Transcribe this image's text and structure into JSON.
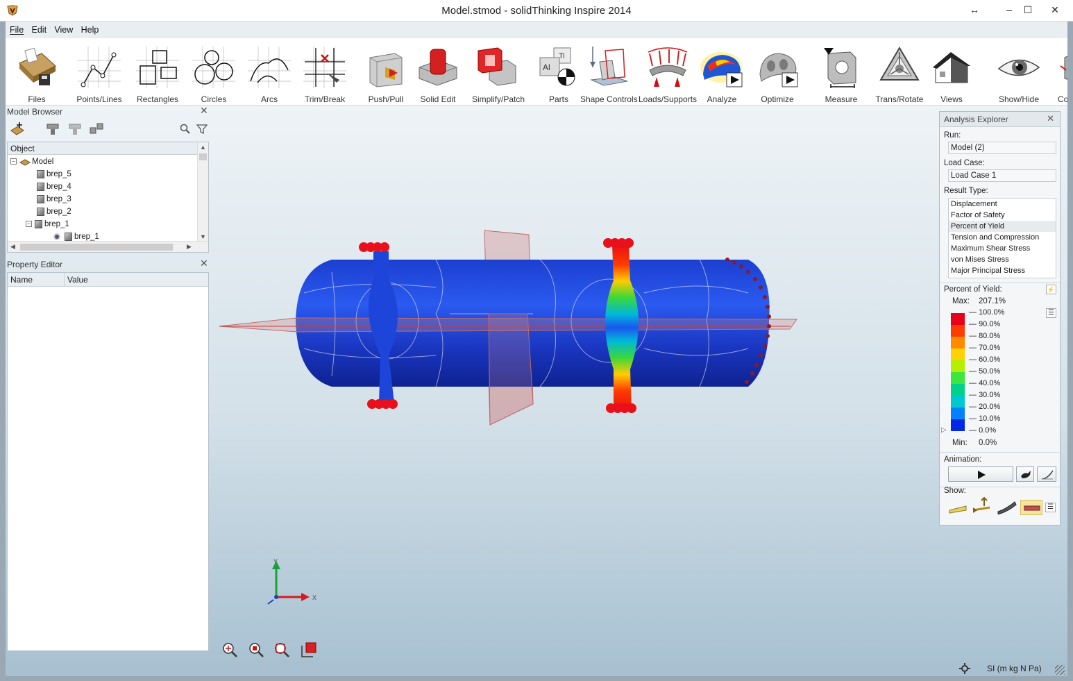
{
  "window": {
    "title": "Model.stmod - solidThinking Inspire 2014",
    "controls": {
      "restore_arrows": "↔",
      "minimize": "–",
      "maximize": "☐",
      "close": "✕"
    }
  },
  "menu": [
    "File",
    "Edit",
    "View",
    "Help"
  ],
  "toolbar": [
    {
      "label": "Files",
      "icon": "files-icon"
    },
    {
      "label": "Points/Lines",
      "icon": "points-lines-icon"
    },
    {
      "label": "Rectangles",
      "icon": "rectangles-icon"
    },
    {
      "label": "Circles",
      "icon": "circles-icon"
    },
    {
      "label": "Arcs",
      "icon": "arcs-icon"
    },
    {
      "label": "Trim/Break",
      "icon": "trim-break-icon"
    },
    {
      "label": "Push/Pull",
      "icon": "push-pull-icon"
    },
    {
      "label": "Solid Edit",
      "icon": "solid-edit-icon"
    },
    {
      "label": "Simplify/Patch",
      "icon": "simplify-patch-icon"
    },
    {
      "label": "Parts",
      "icon": "parts-icon"
    },
    {
      "label": "Shape Controls",
      "icon": "shape-controls-icon"
    },
    {
      "label": "Loads/Supports",
      "icon": "loads-supports-icon"
    },
    {
      "label": "Analyze",
      "icon": "analyze-icon"
    },
    {
      "label": "Optimize",
      "icon": "optimize-icon"
    },
    {
      "label": "Measure",
      "icon": "measure-icon"
    },
    {
      "label": "Trans/Rotate",
      "icon": "trans-rotate-icon"
    },
    {
      "label": "Views",
      "icon": "views-icon"
    },
    {
      "label": "Show/Hide",
      "icon": "show-hide-icon"
    },
    {
      "label": "Co",
      "icon": "cut-off-icon"
    }
  ],
  "model_browser": {
    "title": "Model Browser",
    "close": "✕",
    "column_header": "Object",
    "tree": [
      {
        "label": "Model",
        "level": 0,
        "expander": "−"
      },
      {
        "label": "brep_5",
        "level": 1
      },
      {
        "label": "brep_4",
        "level": 1
      },
      {
        "label": "brep_3",
        "level": 1
      },
      {
        "label": "brep_2",
        "level": 1
      },
      {
        "label": "brep_1",
        "level": 1,
        "expander": "−"
      },
      {
        "label": "brep_1",
        "level": 2
      }
    ]
  },
  "property_editor": {
    "title": "Property Editor",
    "close": "✕",
    "columns": [
      "Name",
      "Value"
    ]
  },
  "analysis_explorer": {
    "title": "Analysis Explorer",
    "close": "✕",
    "run_label": "Run:",
    "run_value": "Model (2)",
    "load_case_label": "Load Case:",
    "load_case_value": "Load Case 1",
    "result_type_label": "Result Type:",
    "result_types": [
      "Displacement",
      "Factor of Safety",
      "Percent of Yield",
      "Tension and Compression",
      "Maximum Shear Stress",
      "von Mises Stress",
      "Major Principal Stress"
    ],
    "selected_result": "Percent of Yield",
    "legend_title": "Percent of Yield:",
    "max_label": "Max:",
    "max_value": "207.1%",
    "min_label": "Min:",
    "min_value": "0.0%",
    "ticks": [
      "100.0%",
      "90.0%",
      "80.0%",
      "70.0%",
      "60.0%",
      "50.0%",
      "40.0%",
      "30.0%",
      "20.0%",
      "10.0%",
      "0.0%"
    ],
    "legend_colors": [
      "#e8001a",
      "#ff3c00",
      "#ff8a00",
      "#ffd200",
      "#b4f000",
      "#3ce63c",
      "#00d28c",
      "#00c8d2",
      "#0082ff",
      "#0028e6"
    ],
    "animation_label": "Animation:",
    "show_label": "Show:"
  },
  "status": {
    "units": "SI (m kg N Pa)"
  },
  "axes": {
    "y": "Y",
    "x": "X"
  }
}
